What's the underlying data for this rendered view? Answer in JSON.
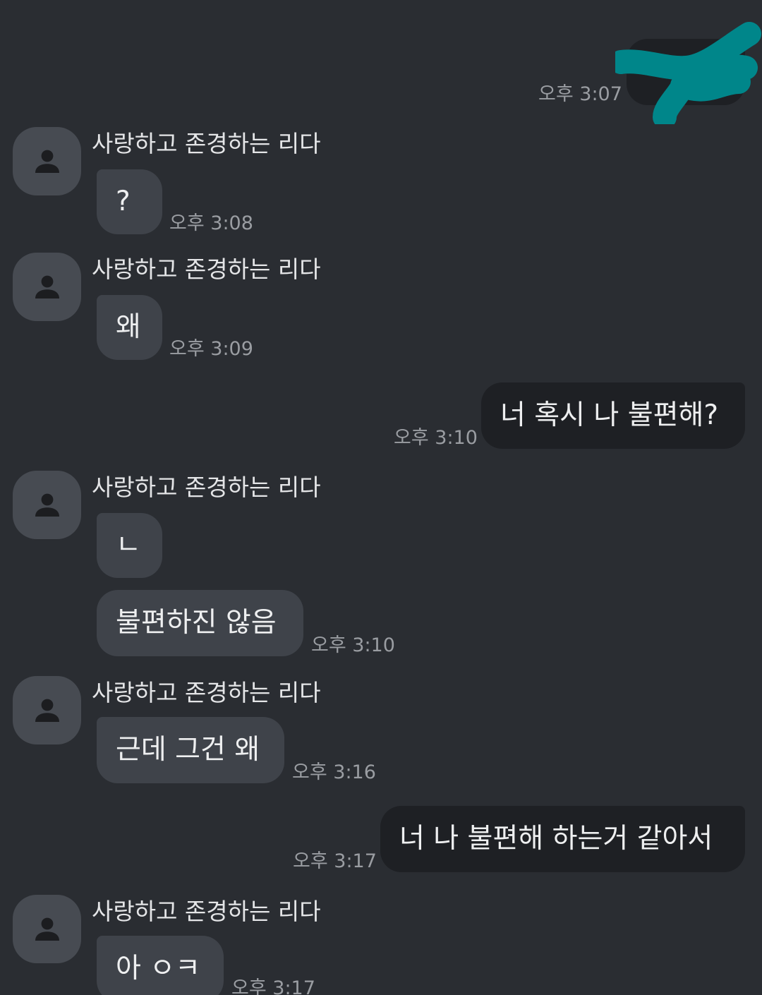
{
  "contact_name": "사랑하고 존경하는 리다",
  "colors": {
    "background": "#2a2d32",
    "incoming_bubble": "#3f434a",
    "outgoing_bubble": "#1e2024",
    "redaction_scribble": "#00868a"
  },
  "messages": [
    {
      "direction": "out",
      "text": "",
      "time": "오후 3:07",
      "redacted": true
    },
    {
      "direction": "in",
      "text": "?",
      "time": "오후 3:08"
    },
    {
      "direction": "in",
      "text": "왜",
      "time": "오후 3:09"
    },
    {
      "direction": "out",
      "text": "너 혹시 나 불편해?",
      "time": "오후 3:10"
    },
    {
      "direction": "in",
      "text": "ㄴ"
    },
    {
      "direction": "in",
      "text": "불편하진 않음",
      "time": "오후 3:10"
    },
    {
      "direction": "in",
      "text": "근데 그건 왜",
      "time": "오후 3:16"
    },
    {
      "direction": "out",
      "text": "너 나 불편해 하는거 같아서",
      "time": "오후 3:17"
    },
    {
      "direction": "in",
      "text": "아 ㅇㅋ",
      "time": "오후 3:17"
    }
  ],
  "icons": {
    "avatar": "person-icon"
  }
}
